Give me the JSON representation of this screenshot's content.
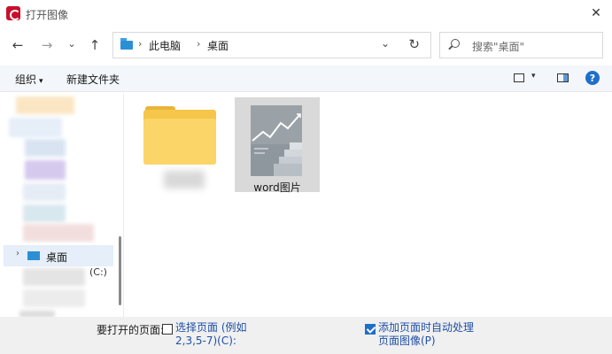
{
  "window": {
    "title": "打开图像",
    "close_glyph": "✕"
  },
  "nav": {
    "back_glyph": "←",
    "forward_glyph": "→",
    "recent_glyph": "⌄",
    "up_glyph": "↑",
    "breadcrumb": [
      "此电脑",
      "桌面"
    ],
    "dropdown_glyph": "⌄",
    "refresh_glyph": "↻",
    "search_placeholder": "搜索\"桌面\""
  },
  "toolbar": {
    "organize_label": "组织",
    "organize_caret": "▾",
    "new_folder_label": "新建文件夹",
    "view_caret": "▾",
    "help_glyph": "?"
  },
  "sidebar": {
    "selected_item": {
      "chevron": "›",
      "label": "桌面"
    },
    "drive_suffix": "(C:)"
  },
  "files": [
    {
      "type": "folder",
      "name": ""
    },
    {
      "type": "image",
      "name": "word图片"
    }
  ],
  "bottom": {
    "pages_label": "要打开的页面:",
    "select_pages_line1": "选择页面 (例如",
    "select_pages_line2": "2,3,5-7)(C):",
    "select_pages_checked": false,
    "add_pages_line1": "添加页面时自动处理",
    "add_pages_line2": "页面图像(P)",
    "add_pages_checked": true
  },
  "colors": {
    "accent": "#1f6fc9",
    "folder": "#f5c64a",
    "selected_bg": "#d9d9d9"
  }
}
